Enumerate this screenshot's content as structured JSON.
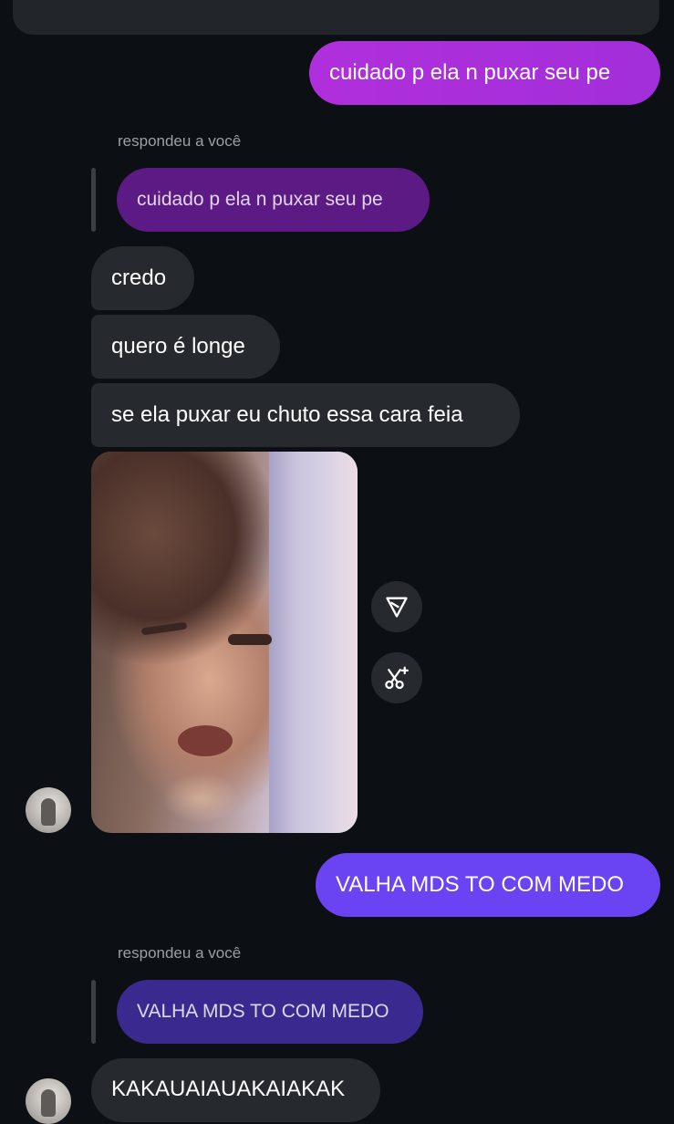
{
  "messages": {
    "sent_1": "cuidado p ela n puxar seu pe",
    "reply_1": {
      "label": "respondeu a você",
      "quoted": "cuidado p ela n puxar seu pe"
    },
    "received": [
      "credo",
      "quero é longe",
      "se ela puxar eu chuto essa cara feia"
    ],
    "sent_2": "VALHA MDS TO COM MEDO",
    "reply_2": {
      "label": "respondeu a você",
      "quoted": "VALHA MDS TO COM MEDO"
    },
    "received_last": "KAKAUAIAUAKAIAKAK"
  },
  "media_actions": {
    "share_icon": "send-icon",
    "remix_icon": "scissors-sparkle-icon"
  },
  "colors": {
    "background": "#0c0f13",
    "received_bubble": "#262a2f",
    "sent_1_bubble": "#a62ed9",
    "sent_2_bubble": "#6a43f2",
    "quoted_1_bubble": "#5c1a85",
    "quoted_2_bubble": "#3a2a8f"
  }
}
